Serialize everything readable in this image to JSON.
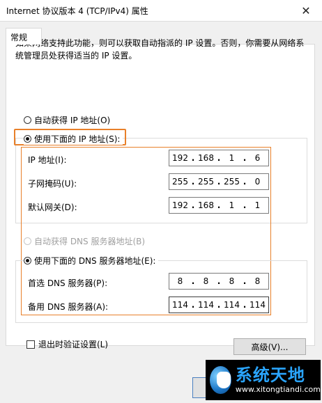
{
  "window": {
    "title": "Internet 协议版本 4 (TCP/IPv4) 属性",
    "close_symbol": "✕"
  },
  "tabs": [
    {
      "label": "常规"
    }
  ],
  "description": "如果网络支持此功能，则可以获取自动指派的 IP 设置。否则，你需要从网络系统管理员处获得适当的 IP 设置。",
  "ip_section": {
    "auto_option": "自动获得 IP 地址(O)",
    "manual_option": "使用下面的 IP 地址(S):",
    "selected": "manual",
    "fields": [
      {
        "label": "IP 地址(I):",
        "octets": [
          "192",
          "168",
          "1",
          "6"
        ]
      },
      {
        "label": "子网掩码(U):",
        "octets": [
          "255",
          "255",
          "255",
          "0"
        ]
      },
      {
        "label": "默认网关(D):",
        "octets": [
          "192",
          "168",
          "1",
          "1"
        ]
      }
    ]
  },
  "dns_section": {
    "auto_option": "自动获得 DNS 服务器地址(B)",
    "auto_disabled": true,
    "manual_option": "使用下面的 DNS 服务器地址(E):",
    "selected": "manual",
    "fields": [
      {
        "label": "首选 DNS 服务器(P):",
        "octets": [
          "8",
          "8",
          "8",
          "8"
        ]
      },
      {
        "label": "备用 DNS 服务器(A):",
        "octets": [
          "114",
          "114",
          "114",
          "114"
        ]
      }
    ]
  },
  "validate_on_exit": {
    "label": "退出时验证设置(L)",
    "checked": false
  },
  "buttons": {
    "advanced": "高级(V)..."
  },
  "watermark": {
    "name": "系统天地",
    "url": "www.xitongtiandi.com"
  },
  "colors": {
    "highlight": "#e8802a",
    "dialog_bg": "#f0f0f0",
    "watermark_text": "#2aa5ff"
  },
  "icons": {
    "close": "close-icon",
    "watermark_logo": "xitongtiandi-logo"
  }
}
